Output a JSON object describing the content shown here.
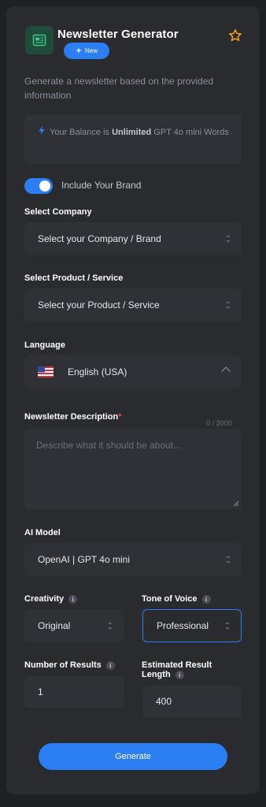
{
  "header": {
    "title": "Newsletter Generator",
    "badge": "New",
    "description": "Generate a newsletter based on the provided information"
  },
  "balance": {
    "prefix": "Your Balance is",
    "amount": "Unlimited",
    "model": "GPT 4o mini",
    "unit": "Words"
  },
  "brand_toggle": {
    "label": "Include Your Brand",
    "on": true
  },
  "company": {
    "label": "Select Company",
    "value": "Select your Company / Brand"
  },
  "product": {
    "label": "Select Product / Service",
    "value": "Select your Product / Service"
  },
  "language": {
    "label": "Language",
    "value": "English (USA)"
  },
  "newsletter_description": {
    "label": "Newsletter Description",
    "required_mark": "*",
    "counter": "0 / 2000",
    "placeholder": "Describe what it should be about..."
  },
  "ai_model": {
    "label": "AI Model",
    "value": "OpenAI | GPT 4o mini"
  },
  "creativity": {
    "label": "Creativity",
    "value": "Original"
  },
  "tone": {
    "label": "Tone of Voice",
    "value": "Professional"
  },
  "num_results": {
    "label": "Number of Results",
    "value": "1"
  },
  "est_length": {
    "label_line1": "Estimated Result",
    "label_line2": "Length",
    "value": "400"
  },
  "generate_label": "Generate",
  "colors": {
    "accent": "#2c7ef3",
    "card": "#2a2b2f",
    "field": "#303136",
    "star": "#f5a524"
  }
}
